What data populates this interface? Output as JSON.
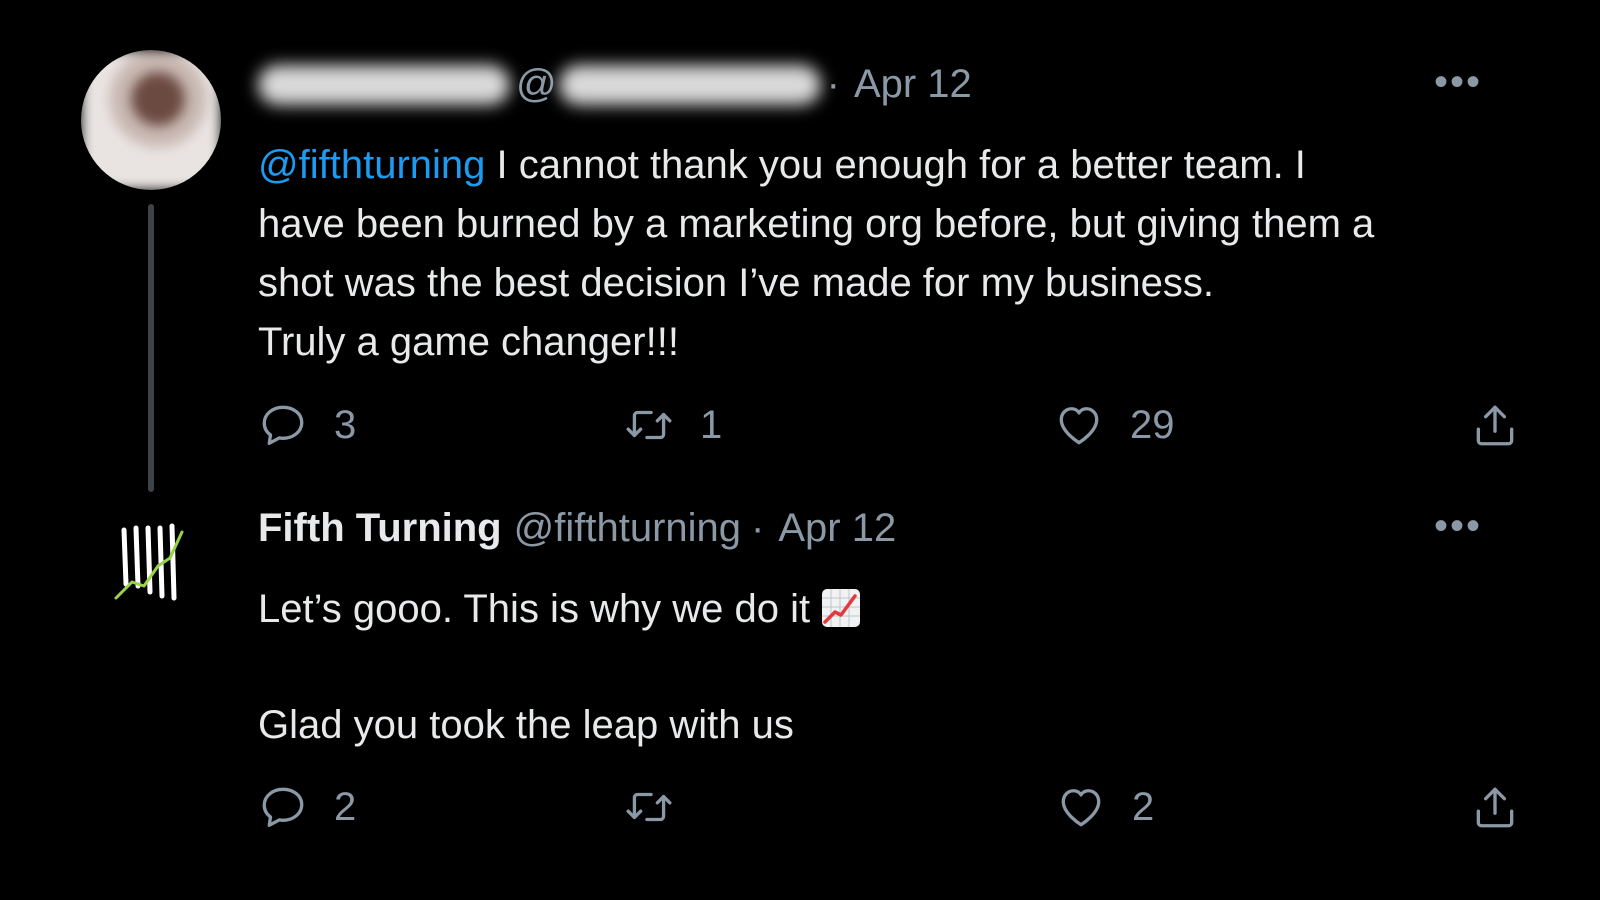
{
  "reply": {
    "handle_prefix": "@",
    "separator": "·",
    "date": "Apr 12",
    "more_label": "•••",
    "mention": "@fifthturning",
    "text_lines": [
      " I cannot thank you enough for a better team. I",
      "have been burned by a marketing org before, but giving them a",
      "shot was the best decision I’ve made for my business.",
      "Truly a game changer!!!"
    ],
    "actions": {
      "reply_count": "3",
      "retweet_count": "1",
      "like_count": "29"
    }
  },
  "response": {
    "display_name": "Fifth Turning",
    "handle": "@fifthturning",
    "separator": "·",
    "date": "Apr 12",
    "more_label": "•••",
    "line1": "Let’s gooo. This is why we do it",
    "line2": "Glad you took the leap with us",
    "actions": {
      "reply_count": "2",
      "retweet_count": "",
      "like_count": "2"
    }
  },
  "colors": {
    "background": "#000000",
    "text": "#e7e9ea",
    "muted": "#8b98a5",
    "mention": "#1d9bf0",
    "logo_accent": "#9ad34a"
  },
  "icons": [
    "reply-icon",
    "retweet-icon",
    "like-icon",
    "share-icon",
    "chart-increasing-emoji"
  ]
}
